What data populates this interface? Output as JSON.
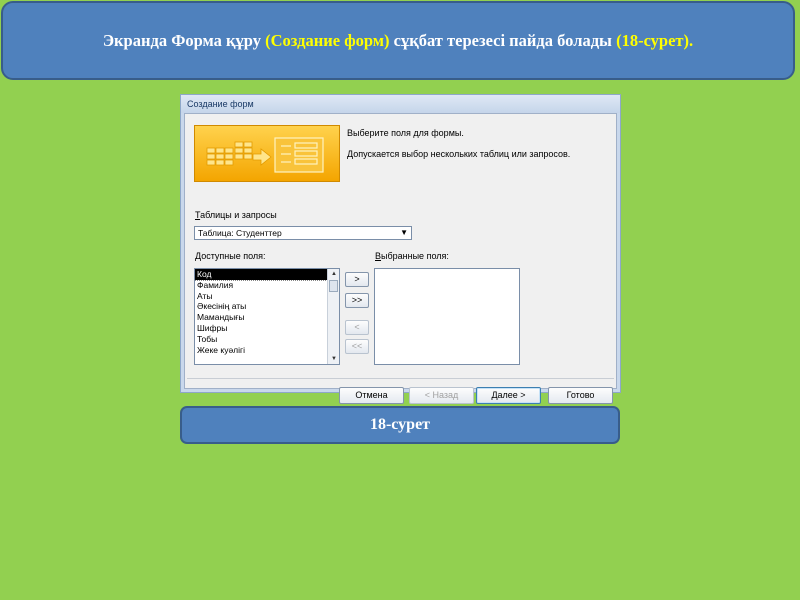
{
  "slide": {
    "title_parts": [
      {
        "text": "Экранда Форма құру ",
        "highlight": false
      },
      {
        "text": "(Создание форм)",
        "highlight": true
      },
      {
        "text": " сұқбат терезесі пайда болады ",
        "highlight": false
      },
      {
        "text": "(18-сурет).",
        "highlight": true
      }
    ],
    "caption": "18-сурет",
    "colors": {
      "background": "#92d050",
      "box": "#4f81bd",
      "highlight": "#ffff00"
    }
  },
  "dialog": {
    "title": "Создание форм",
    "instruction1": "Выберите поля для формы.",
    "instruction2": "Допускается выбор нескольких таблиц или запросов.",
    "tables_label": "Таблицы и запросы",
    "tables_value": "Таблица: Студенттер",
    "available_label": "Доступные поля:",
    "available_fields": [
      "Код",
      "Фамилия",
      "Аты",
      "Әкесінің аты",
      "Мамандығы",
      "Шифры",
      "Тобы",
      "Жеке куәлігі"
    ],
    "selected_field_index": 0,
    "selected_label": "Выбранные поля:",
    "selected_fields": [],
    "move_buttons": [
      ">",
      ">>",
      "<",
      "<<"
    ],
    "buttons": {
      "cancel": "Отмена",
      "back": "< Назад",
      "next": "Далее >",
      "finish": "Готово"
    }
  }
}
